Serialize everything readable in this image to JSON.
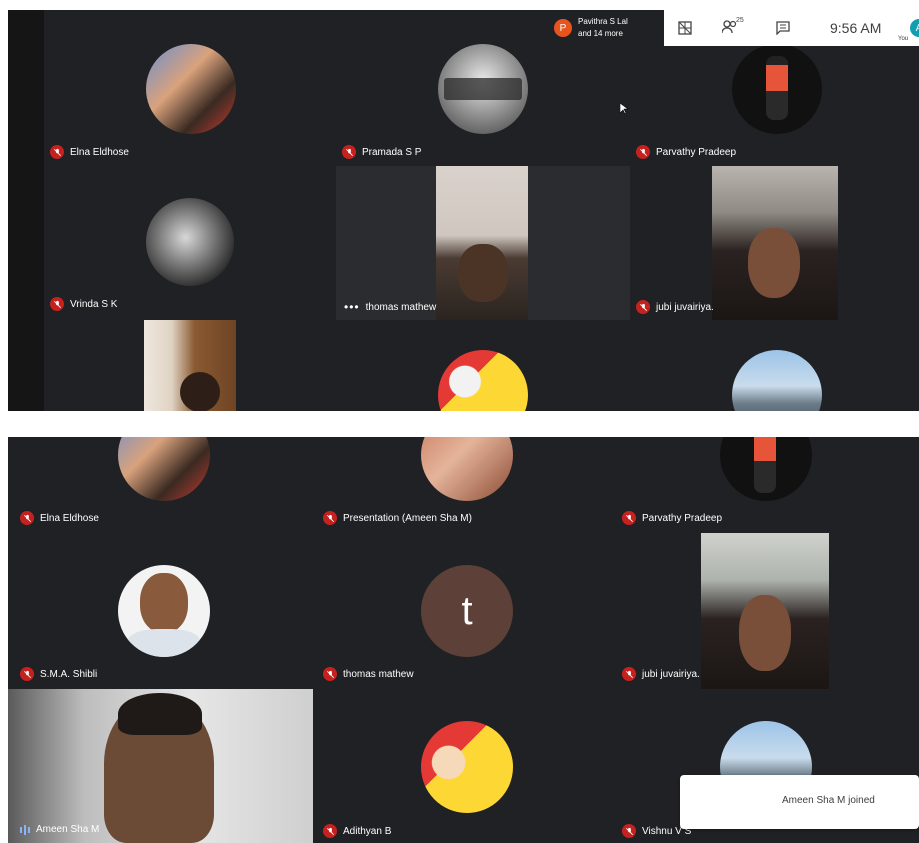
{
  "meeting": {
    "time": "9:56 AM",
    "participant_count": "25",
    "you_label": "You",
    "self_initial": "A",
    "presenter_initial": "P",
    "presenter_name": "Pavithra S Lal",
    "presenter_more": "and 14 more"
  },
  "top_grid": [
    {
      "name": "Elna Eldhose"
    },
    {
      "name": "Pramada S P"
    },
    {
      "name": "Parvathy Pradeep"
    },
    {
      "name": "Vrinda S K"
    },
    {
      "name": "thomas mathew"
    },
    {
      "name": "jubi juvairiya."
    }
  ],
  "bottom_grid": [
    {
      "name": "Elna Eldhose"
    },
    {
      "name": "Presentation (Ameen Sha M)"
    },
    {
      "name": "Parvathy Pradeep"
    },
    {
      "name": "S.M.A. Shibli"
    },
    {
      "name": "thomas mathew",
      "initial": "t"
    },
    {
      "name": "jubi juvairiya."
    },
    {
      "name": "Ameen Sha M"
    },
    {
      "name": "Adithyan B"
    },
    {
      "name": "Vishnu V S"
    }
  ],
  "toast": {
    "text": "Ameen Sha M joined"
  },
  "colors": {
    "background": "#202124",
    "mute_red": "#c5221f",
    "avatar_brown": "#5d4037",
    "presenter_orange": "#e8541e",
    "self_teal": "#129eaf"
  },
  "icons": [
    "grid-icon",
    "people-icon",
    "chat-icon",
    "mic-off-icon",
    "speaking-icon"
  ]
}
